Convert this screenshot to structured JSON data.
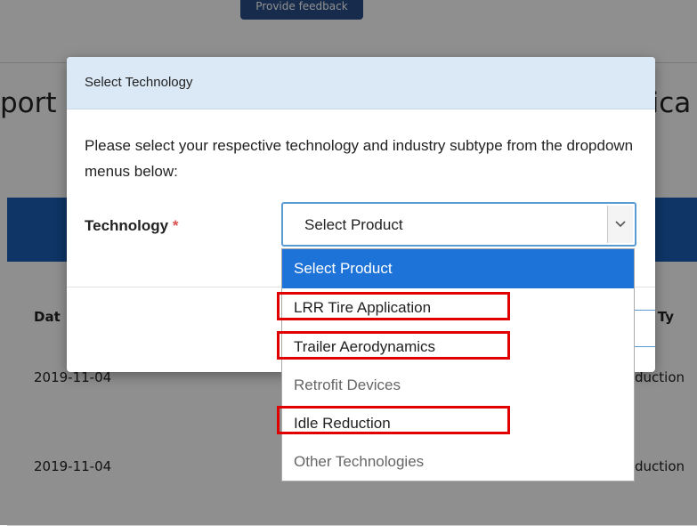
{
  "background": {
    "top_button_label": "Provide feedback",
    "heading_left": "port",
    "heading_right": "lica",
    "table": {
      "header_left": "Dat",
      "header_right": "gy Ty",
      "rows": [
        {
          "date": "2019-11-04",
          "right": "duction"
        },
        {
          "date": "2019-11-04",
          "right": "duction"
        }
      ]
    }
  },
  "modal": {
    "title": "Select Technology",
    "description": "Please select your respective technology and industry subtype from the dropdown menus below:",
    "field_label": "Technology",
    "required_marker": "*",
    "select": {
      "value": "Select Product",
      "options": [
        {
          "label": "Select Product",
          "selected": true
        },
        {
          "label": "LRR Tire Application"
        },
        {
          "label": "Trailer Aerodynamics"
        },
        {
          "label": "Retrofit Devices",
          "muted": true
        },
        {
          "label": "Idle Reduction"
        },
        {
          "label": "Other Technologies",
          "muted": true
        }
      ]
    }
  },
  "colors": {
    "modal_header_bg": "#dbe9f6",
    "selected_option_bg": "#1e73d8",
    "annotation_red": "#e00000",
    "background_blue_bar": "#1a5fb4"
  },
  "icons": {
    "select_arrow": "chevron-down-icon"
  }
}
